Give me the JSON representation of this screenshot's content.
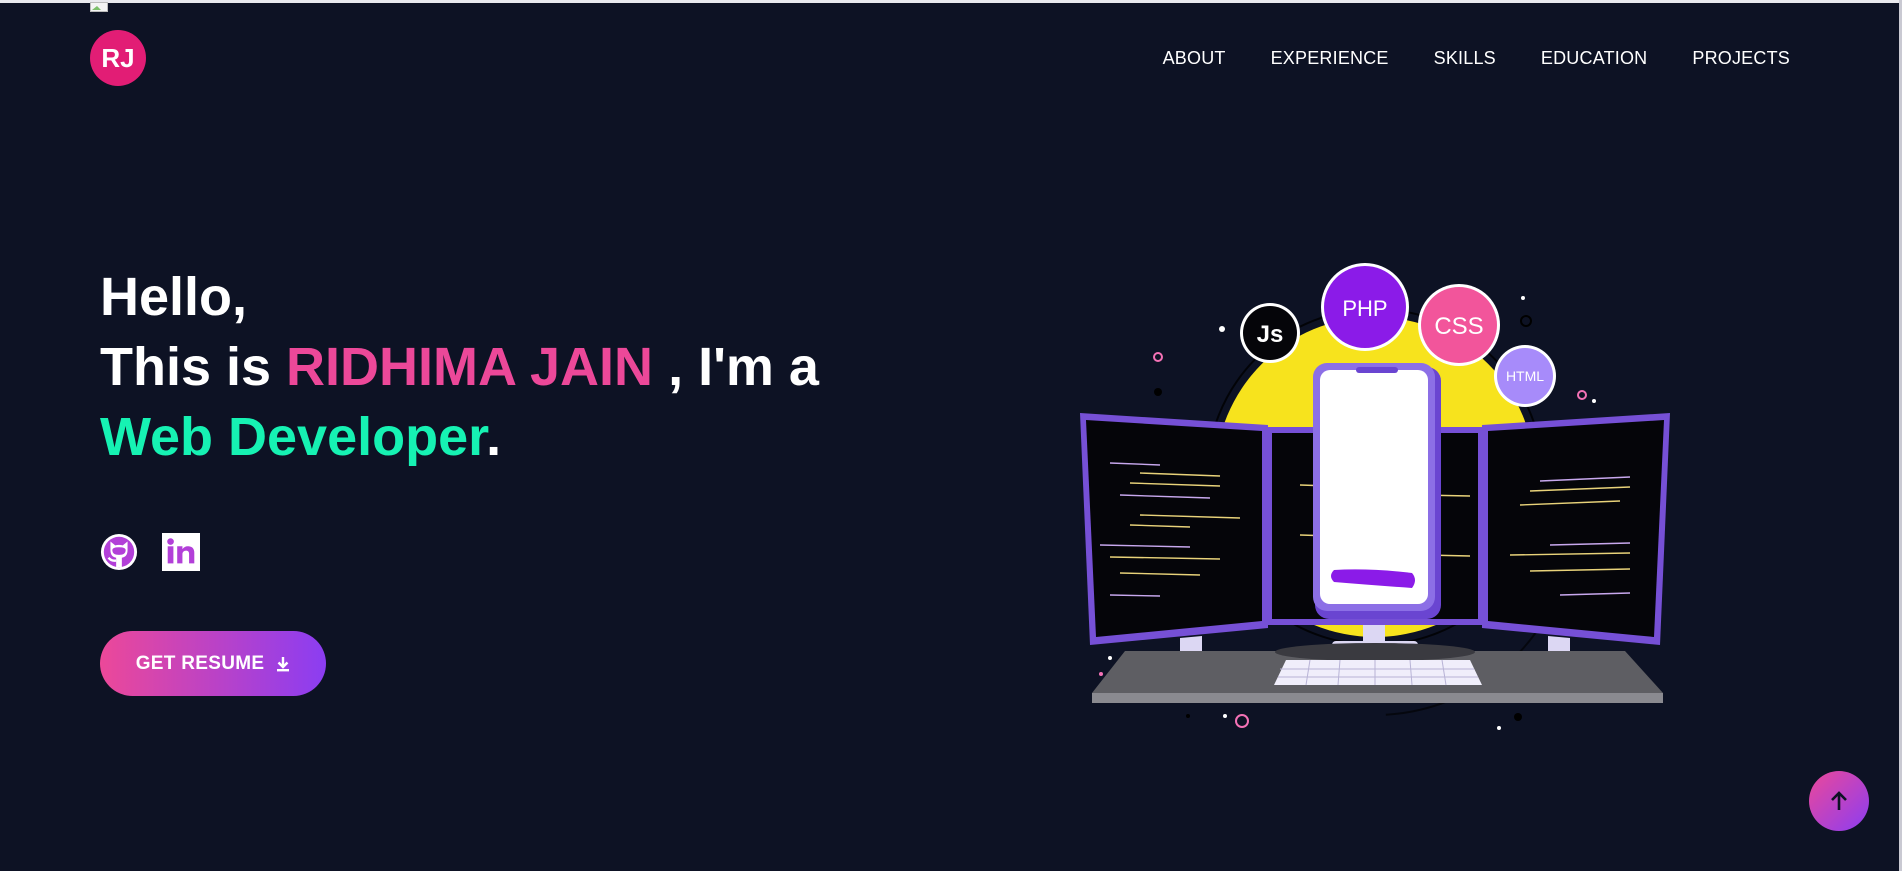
{
  "brand": {
    "logo_text": "RJ",
    "accent": "#e21d75"
  },
  "nav": {
    "items": [
      "ABOUT",
      "EXPERIENCE",
      "SKILLS",
      "EDUCATION",
      "PROJECTS"
    ]
  },
  "hero": {
    "greeting": "Hello,",
    "intro_prefix": "This is ",
    "name": "RIDHIMA JAIN",
    "intro_suffix": " , I'm a",
    "role": "Web Developer",
    "role_suffix": ".",
    "name_color": "#ec4899",
    "role_color": "#16f2b3"
  },
  "social": {
    "icons": [
      "github-icon",
      "linkedin-icon"
    ]
  },
  "cta": {
    "label": "GET RESUME",
    "icon": "download-icon"
  },
  "illustration": {
    "badges": [
      "Js",
      "PHP",
      "CSS",
      "HTML"
    ]
  },
  "scroll_top": {
    "icon": "arrow-up-icon"
  },
  "colors": {
    "background": "#0d1224",
    "gradient_start": "#ec4899",
    "gradient_end": "#8b3df2"
  }
}
